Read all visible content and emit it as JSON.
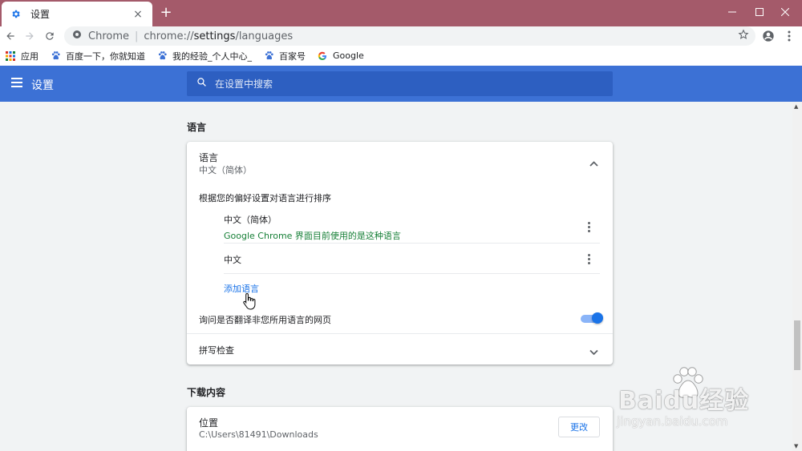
{
  "browser": {
    "tab_title": "设置",
    "tab_close": "×",
    "new_tab": "+",
    "omnibox": {
      "site_name": "Chrome",
      "separator": "|",
      "url_scheme": "chrome://",
      "url_host": "settings",
      "url_path": "/languages"
    },
    "bookmarks": [
      {
        "label": "应用",
        "icon": "apps-grid-icon"
      },
      {
        "label": "百度一下，你就知道",
        "icon": "baidu-paw-icon"
      },
      {
        "label": "我的经验_个人中心_",
        "icon": "baidu-paw-icon"
      },
      {
        "label": "百家号",
        "icon": "baidu-paw-icon"
      },
      {
        "label": "Google",
        "icon": "google-g-icon"
      }
    ]
  },
  "settings": {
    "title": "设置",
    "search_placeholder": "在设置中搜索",
    "languages_section": {
      "title": "语言",
      "card": {
        "label": "语言",
        "current_language": "中文（简体）",
        "sort_instruction": "根据您的偏好设置对语言进行排序",
        "languages": [
          {
            "name": "中文（简体）",
            "note": "Google Chrome 界面目前使用的是这种语言"
          },
          {
            "name": "中文",
            "note": ""
          }
        ],
        "add_language_link": "添加语言",
        "offer_translate_label": "询问是否翻译非您所用语言的网页",
        "offer_translate_enabled": true,
        "spell_check_label": "拼写检查"
      }
    },
    "downloads_section": {
      "title": "下载内容",
      "location_label": "位置",
      "location_path": "C:\\Users\\81491\\Downloads",
      "change_button": "更改"
    }
  },
  "watermark": {
    "brand": "Baidu经验",
    "url": "jingyan.baidu.com"
  },
  "colors": {
    "titlebar": "#a45a6a",
    "settings_header": "#3c71d5",
    "search_box": "#2d5fc1",
    "accent": "#1a73e8",
    "green_note": "#188038"
  }
}
